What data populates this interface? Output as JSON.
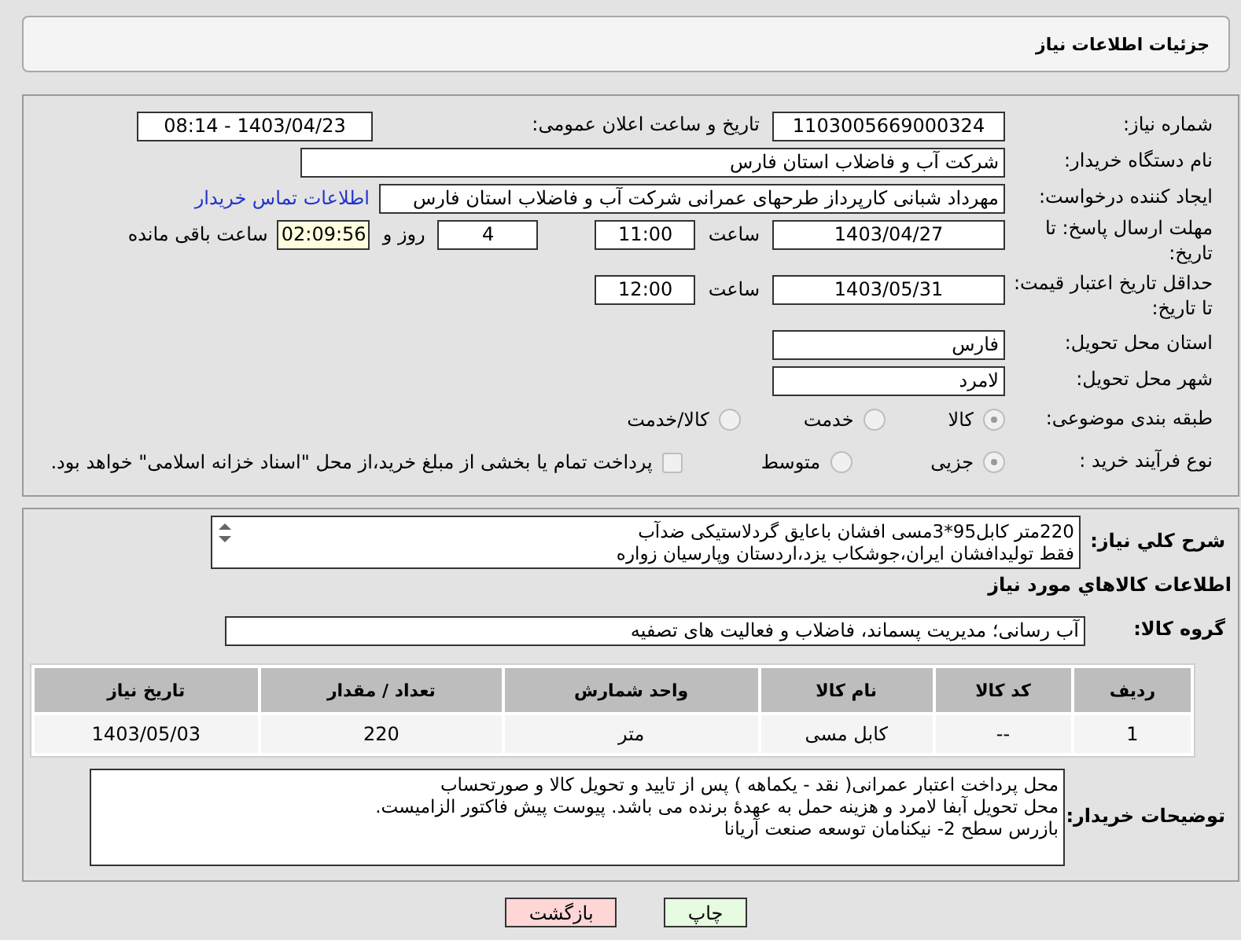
{
  "header": {
    "title": "جزئیات اطلاعات نیاز"
  },
  "need_number": {
    "label": "شماره نیاز:",
    "value": "1103005669000324"
  },
  "announce": {
    "label": "تاریخ و ساعت اعلان عمومی:",
    "value": "1403/04/23 - 08:14"
  },
  "buyer_org": {
    "label": "نام دستگاه خریدار:",
    "value": "شرکت آب و فاضلاب استان فارس"
  },
  "requester": {
    "label": "ایجاد کننده درخواست:",
    "value": "مهرداد شبانی کارپرداز طرحهای عمرانی  شرکت آب و فاضلاب استان فارس",
    "link": "اطلاعات تماس خریدار"
  },
  "reply_deadline": {
    "label": "مهلت ارسال پاسخ: تا تاریخ:",
    "date": "1403/04/27",
    "time_label": "ساعت",
    "time": "11:00",
    "days": "4",
    "days_label": "روز و",
    "remaining": "02:09:56",
    "remaining_label": "ساعت باقی مانده"
  },
  "price_validity": {
    "label": "حداقل تاریخ اعتبار قیمت: تا تاریخ:",
    "date": "1403/05/31",
    "time_label": "ساعت",
    "time": "12:00"
  },
  "province": {
    "label": "استان محل تحویل:",
    "value": "فارس"
  },
  "city": {
    "label": "شهر محل تحویل:",
    "value": "لامرد"
  },
  "category": {
    "label": "طبقه بندی موضوعی:",
    "options": [
      {
        "label": "کالا",
        "selected": true
      },
      {
        "label": "خدمت",
        "selected": false
      },
      {
        "label": "کالا/خدمت",
        "selected": false
      }
    ]
  },
  "purchase_type": {
    "label": "نوع فرآیند خرید :",
    "options": [
      {
        "label": "جزیی",
        "selected": true
      },
      {
        "label": "متوسط",
        "selected": false
      }
    ],
    "treasury": {
      "label": "پرداخت تمام یا بخشی از مبلغ خرید،از محل \"اسناد خزانه اسلامی\" خواهد بود.",
      "checked": false
    }
  },
  "description": {
    "label": "شرح کلي نياز:",
    "lines": [
      "220متر کابل95*3مسی افشان باعایق گردلاستیکی ضدآب",
      "فقط تولیدافشان ایران،جوشکاب یزد،اردستان وپارسیان زواره"
    ]
  },
  "goods_heading": "اطلاعات کالاهاي مورد نياز",
  "goods_group": {
    "label": "گروه کالا:",
    "value": "آب رسانی؛ مدیریت پسماند، فاضلاب و فعالیت های تصفیه"
  },
  "table": {
    "columns": [
      "ردیف",
      "کد کالا",
      "نام کالا",
      "واحد شمارش",
      "تعداد / مقدار",
      "تاریخ نیاز"
    ],
    "rows": [
      [
        "1",
        "--",
        "کابل مسی",
        "متر",
        "220",
        "1403/05/03"
      ]
    ]
  },
  "buyer_notes": {
    "label": "توضیحات خریدار:",
    "lines": [
      "محل پرداخت اعتبار عمرانی( نقد - یکماهه ) پس از تایید و تحویل کالا و صورتحساب",
      "محل تحویل آبفا لامرد و هزینه حمل به عهدهٔ برنده می باشد. پیوست پیش فاکتور الزامیست.",
      "بازرس سطح 2- نیکنامان توسعه صنعت آریانا"
    ]
  },
  "buttons": [
    {
      "label": "چاپ",
      "kind": "print"
    },
    {
      "label": "بازگشت",
      "kind": "back"
    }
  ]
}
